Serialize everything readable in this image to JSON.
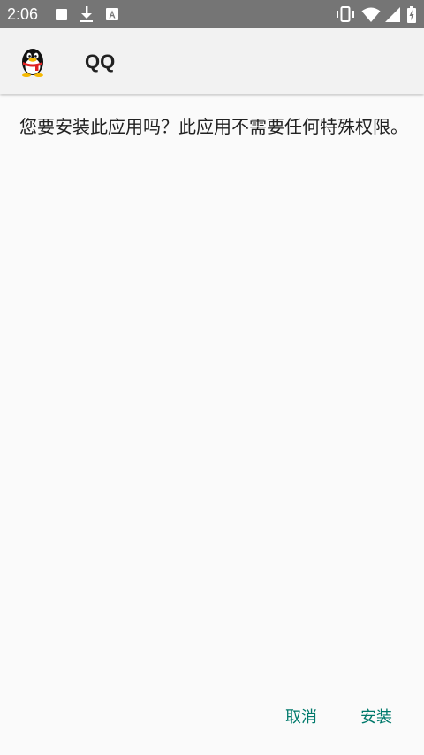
{
  "status_bar": {
    "time": "2:06",
    "icons": [
      "stop-icon",
      "download-icon",
      "font-a-icon",
      "vibrate-icon",
      "wifi-icon",
      "signal-icon",
      "battery-charging-icon"
    ]
  },
  "app_bar": {
    "title": "QQ",
    "icon": "qq-penguin-logo"
  },
  "message": "您要安装此应用吗？此应用不需要任何特殊权限。",
  "actions": {
    "cancel_label": "取消",
    "install_label": "安装"
  },
  "colors": {
    "status_bar": "#757575",
    "app_bar": "#f2f2f2",
    "background": "#fafafa",
    "accent": "#00796b",
    "text": "#212121"
  }
}
